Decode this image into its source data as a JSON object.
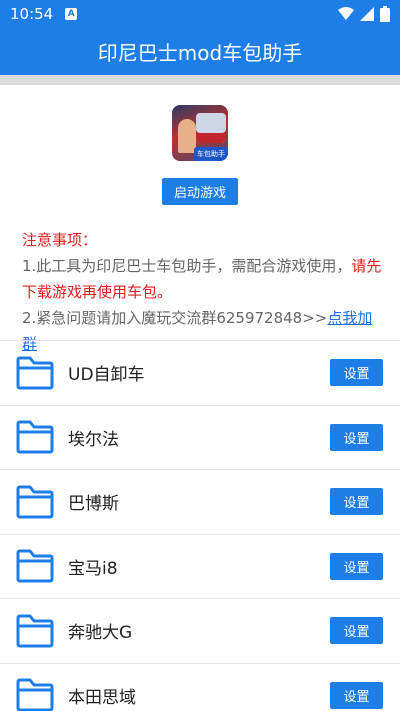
{
  "status": {
    "time": "10:54",
    "notification_icon_label": "A"
  },
  "app_bar": {
    "title": "印尼巴士mod车包助手"
  },
  "app_icon": {
    "badge": "车包助手"
  },
  "launch_button": "启动游戏",
  "notes": {
    "title": "注意事项：",
    "line1_prefix": "1.此工具为印尼巴士车包助手，需配合游戏使用，",
    "line1_red": "请先下载游戏再使用车包。",
    "line2_prefix": "2.紧急问题请加入魔玩交流群625972848>>",
    "line2_link": "点我加群"
  },
  "list": {
    "button_label": "设置",
    "items": [
      {
        "name": "UD自卸车"
      },
      {
        "name": "埃尔法"
      },
      {
        "name": "巴博斯"
      },
      {
        "name": "宝马i8"
      },
      {
        "name": "奔驰大G"
      },
      {
        "name": "本田思域"
      }
    ]
  },
  "colors": {
    "primary": "#1c7ee6",
    "warning": "#e02020",
    "link": "#1c6fd8"
  }
}
